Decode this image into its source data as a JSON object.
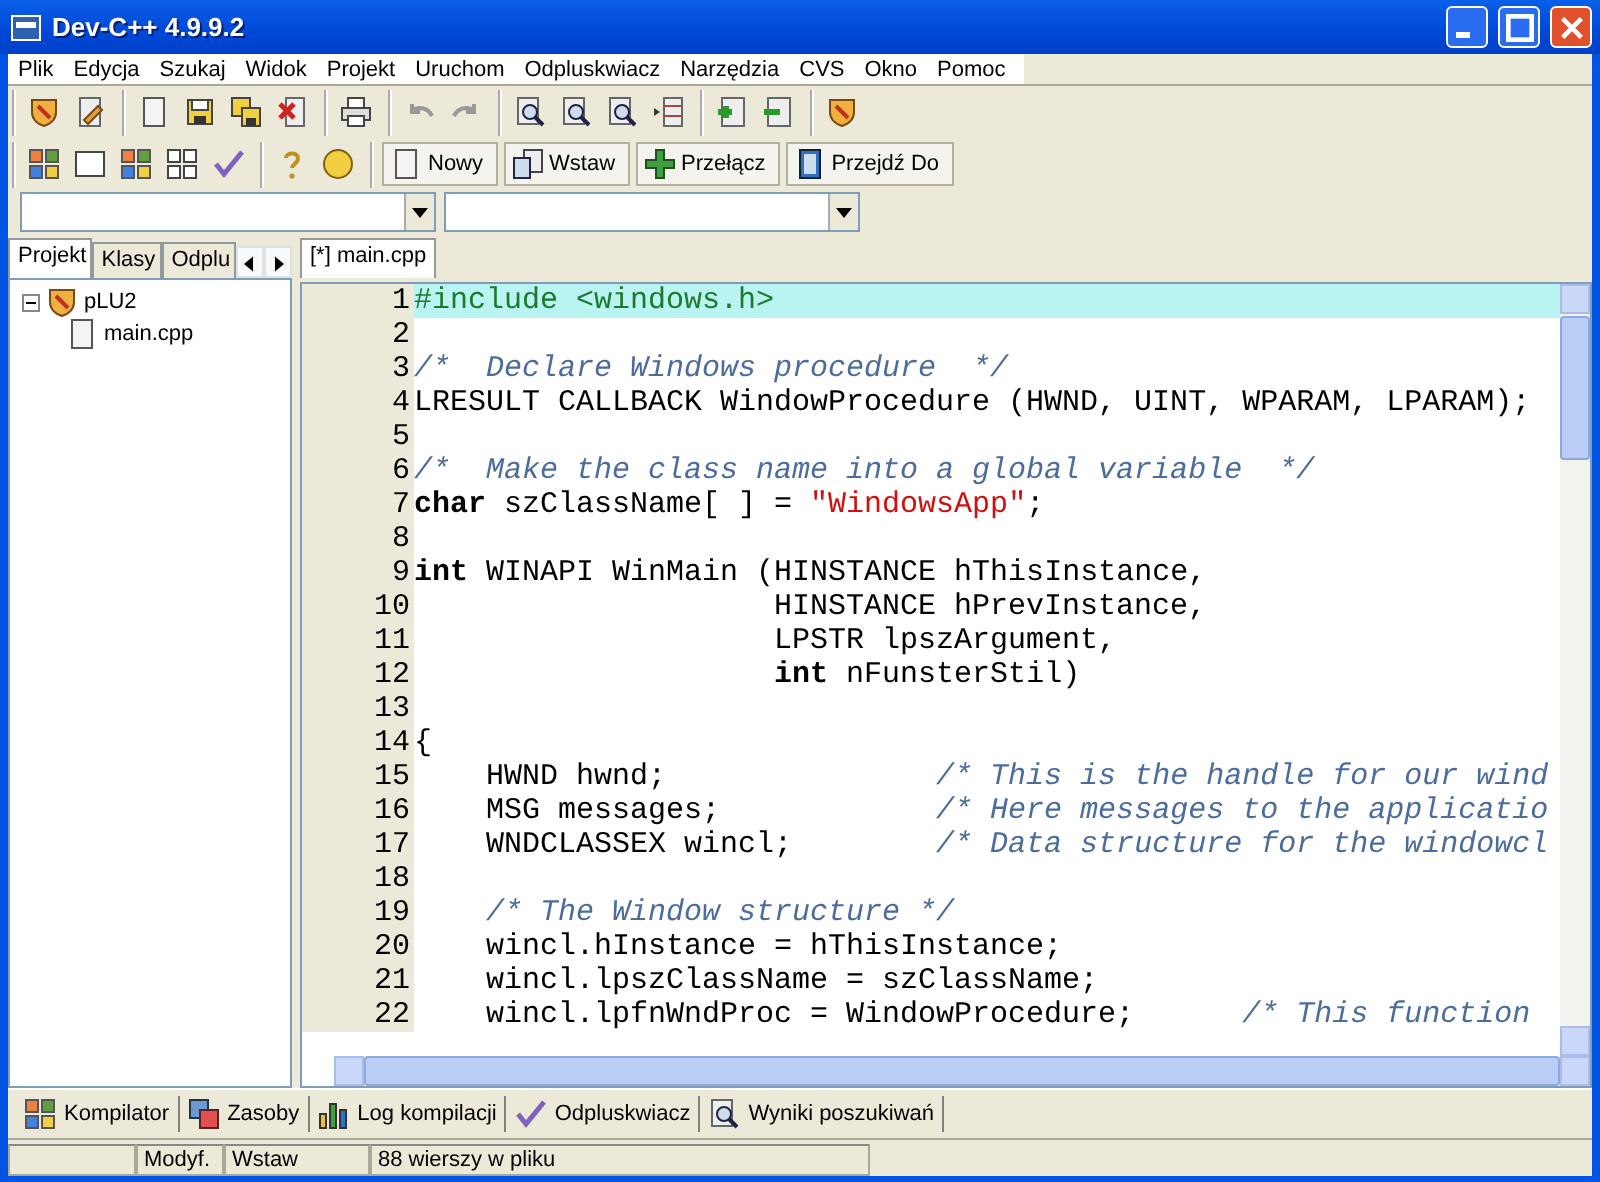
{
  "window": {
    "title": "Dev-C++ 4.9.9.2"
  },
  "menu": [
    "Plik",
    "Edycja",
    "Szukaj",
    "Widok",
    "Projekt",
    "Uruchom",
    "Odpluskwiacz",
    "Narzędzia",
    "CVS",
    "Okno",
    "Pomoc"
  ],
  "toolbar_buttons": [
    {
      "label": "Nowy"
    },
    {
      "label": "Wstaw"
    },
    {
      "label": "Przełącz"
    },
    {
      "label": "Przejdź Do"
    }
  ],
  "left_panel": {
    "tabs": [
      {
        "label": "Projekt",
        "selected": true
      },
      {
        "label": "Klasy",
        "selected": false
      },
      {
        "label": "Odplu",
        "selected": false
      }
    ],
    "tree": [
      {
        "label": "pLU2",
        "expanded": true,
        "children": [
          {
            "label": "main.cpp"
          }
        ]
      }
    ]
  },
  "editor": {
    "tabs": [
      {
        "label": "[*] main.cpp",
        "selected": true
      }
    ],
    "lines": [
      {
        "number": "1",
        "highlighted": true,
        "segments": [
          {
            "kind": "preprocessor",
            "text": "#include <windows.h>"
          }
        ]
      },
      {
        "number": "2",
        "highlighted": false
      },
      {
        "number": "3",
        "highlighted": false,
        "segments": [
          {
            "kind": "comment",
            "text": "/*  Declare Windows procedure  */"
          }
        ]
      },
      {
        "number": "4",
        "highlighted": false,
        "segments": [
          {
            "kind": "plain",
            "text": "LRESULT CALLBACK WindowProcedure (HWND, UINT, WPARAM, LPARAM);"
          }
        ]
      },
      {
        "number": "5",
        "highlighted": false
      },
      {
        "number": "6",
        "highlighted": false,
        "segments": [
          {
            "kind": "comment",
            "text": "/*  Make the class name into a global variable  */"
          }
        ]
      },
      {
        "number": "7",
        "highlighted": false,
        "segments": [
          {
            "kind": "keyword",
            "text": "char"
          },
          {
            "kind": "plain",
            "text": " szClassName[ ] = "
          },
          {
            "kind": "string",
            "text": "\"WindowsApp\""
          },
          {
            "kind": "plain",
            "text": ";"
          }
        ]
      },
      {
        "number": "8",
        "highlighted": false
      },
      {
        "number": "9",
        "highlighted": false,
        "segments": [
          {
            "kind": "keyword",
            "text": "int"
          },
          {
            "kind": "plain",
            "text": " WINAPI WinMain (HINSTANCE hThisInstance,"
          }
        ]
      },
      {
        "number": "10",
        "highlighted": false,
        "segments": [
          {
            "kind": "plain",
            "text": "                    HINSTANCE hPrevInstance,"
          }
        ]
      },
      {
        "number": "11",
        "highlighted": false,
        "segments": [
          {
            "kind": "plain",
            "text": "                    LPSTR lpszArgument,"
          }
        ]
      },
      {
        "number": "12",
        "highlighted": false,
        "segments": [
          {
            "kind": "keyword",
            "text": "                    int"
          },
          {
            "kind": "plain",
            "text": " nFunsterStil)"
          }
        ]
      },
      {
        "number": "13",
        "highlighted": false
      },
      {
        "number": "14",
        "highlighted": false,
        "segments": [
          {
            "kind": "plain",
            "text": "{"
          }
        ]
      },
      {
        "number": "15",
        "highlighted": false,
        "segments": [
          {
            "kind": "plain",
            "text": "    HWND hwnd;               "
          },
          {
            "kind": "comment",
            "text": "/* This is the handle for our wind"
          }
        ]
      },
      {
        "number": "16",
        "highlighted": false,
        "segments": [
          {
            "kind": "plain",
            "text": "    MSG messages;            "
          },
          {
            "kind": "comment",
            "text": "/* Here messages to the applicatio"
          }
        ]
      },
      {
        "number": "17",
        "highlighted": false,
        "segments": [
          {
            "kind": "plain",
            "text": "    WNDCLASSEX wincl;        "
          },
          {
            "kind": "comment",
            "text": "/* Data structure for the windowcl"
          }
        ]
      },
      {
        "number": "18",
        "highlighted": false
      },
      {
        "number": "19",
        "highlighted": false,
        "segments": [
          {
            "kind": "comment",
            "text": "    /* The Window structure */"
          }
        ]
      },
      {
        "number": "20",
        "highlighted": false,
        "segments": [
          {
            "kind": "plain",
            "text": "    wincl.hInstance = hThisInstance;"
          }
        ]
      },
      {
        "number": "21",
        "highlighted": false,
        "segments": [
          {
            "kind": "plain",
            "text": "    wincl.lpszClassName = szClassName;"
          }
        ]
      },
      {
        "number": "22",
        "highlighted": false,
        "segments": [
          {
            "kind": "plain",
            "text": "    wincl.lpfnWndProc = WindowProcedure;      "
          },
          {
            "kind": "comment",
            "text": "/* This function"
          }
        ]
      }
    ]
  },
  "bottom_tabs": [
    {
      "label": "Kompilator"
    },
    {
      "label": "Zasoby"
    },
    {
      "label": "Log kompilacji"
    },
    {
      "label": "Odpluskwiacz"
    },
    {
      "label": "Wyniki poszukiwań"
    }
  ],
  "status_bar": {
    "modified": "Modyf.",
    "mode": "Wstaw",
    "lines": "88 wierszy w pliku"
  }
}
